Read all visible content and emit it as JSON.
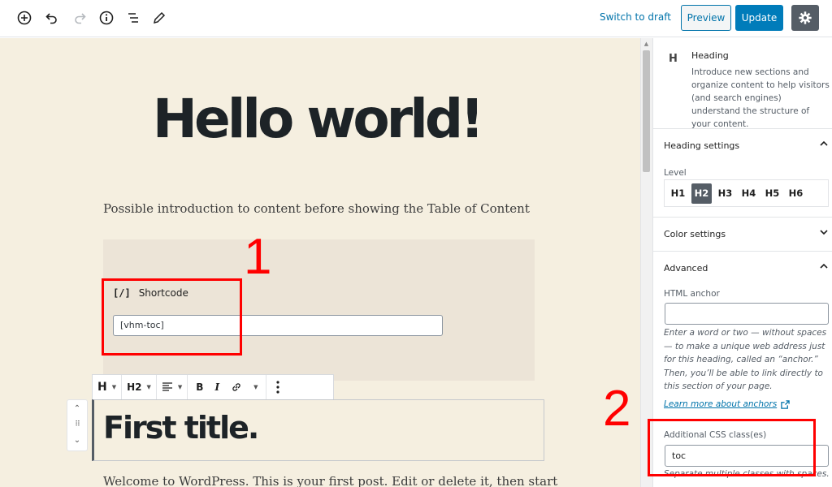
{
  "toolbar": {
    "icons": [
      "add-block-icon",
      "undo-icon",
      "redo-icon",
      "info-icon",
      "block-navigation-icon",
      "edit-mode-icon"
    ],
    "switch_to_draft": "Switch to draft",
    "preview": "Preview",
    "update": "Update",
    "settings_icon": "gear-icon"
  },
  "editor": {
    "post_title": "Hello world!",
    "intro": "Possible introduction to content before showing the Table of Content",
    "shortcode_block": {
      "icon_glyph": "[/]",
      "label": "Shortcode",
      "value": "[vhm-toc]"
    },
    "block_toolbar": {
      "block_type": "H",
      "heading_level": "H2",
      "bold": "B",
      "italic": "I"
    },
    "heading_text": "First title.",
    "welcome_text": "Welcome to WordPress. This is your first post. Edit or delete it, then start"
  },
  "annotations": {
    "one": "1",
    "two": "2",
    "color": "#ff0000"
  },
  "sidebar": {
    "block_card": {
      "icon_glyph": "H",
      "title": "Heading",
      "description": "Introduce new sections and organize content to help visitors (and search engines) understand the structure of your content."
    },
    "heading_settings": {
      "title": "Heading settings",
      "level_label": "Level",
      "levels": [
        "H1",
        "H2",
        "H3",
        "H4",
        "H5",
        "H6"
      ],
      "active_level": "H2"
    },
    "color_settings": {
      "title": "Color settings"
    },
    "advanced": {
      "title": "Advanced",
      "html_anchor_label": "HTML anchor",
      "html_anchor_value": "",
      "help_text": "Enter a word or two — without spaces — to make a unique web address just for this heading, called an “anchor.” Then, you’ll be able to link directly to this section of your page.",
      "learn_more": "Learn more about anchors",
      "css_class_label": "Additional CSS class(es)",
      "css_class_value": "toc",
      "separate_help": "Separate multiple classes with spaces."
    }
  },
  "colors": {
    "accent": "#007cba",
    "link": "#0073aa",
    "canvas_bg": "#f5efe0"
  }
}
